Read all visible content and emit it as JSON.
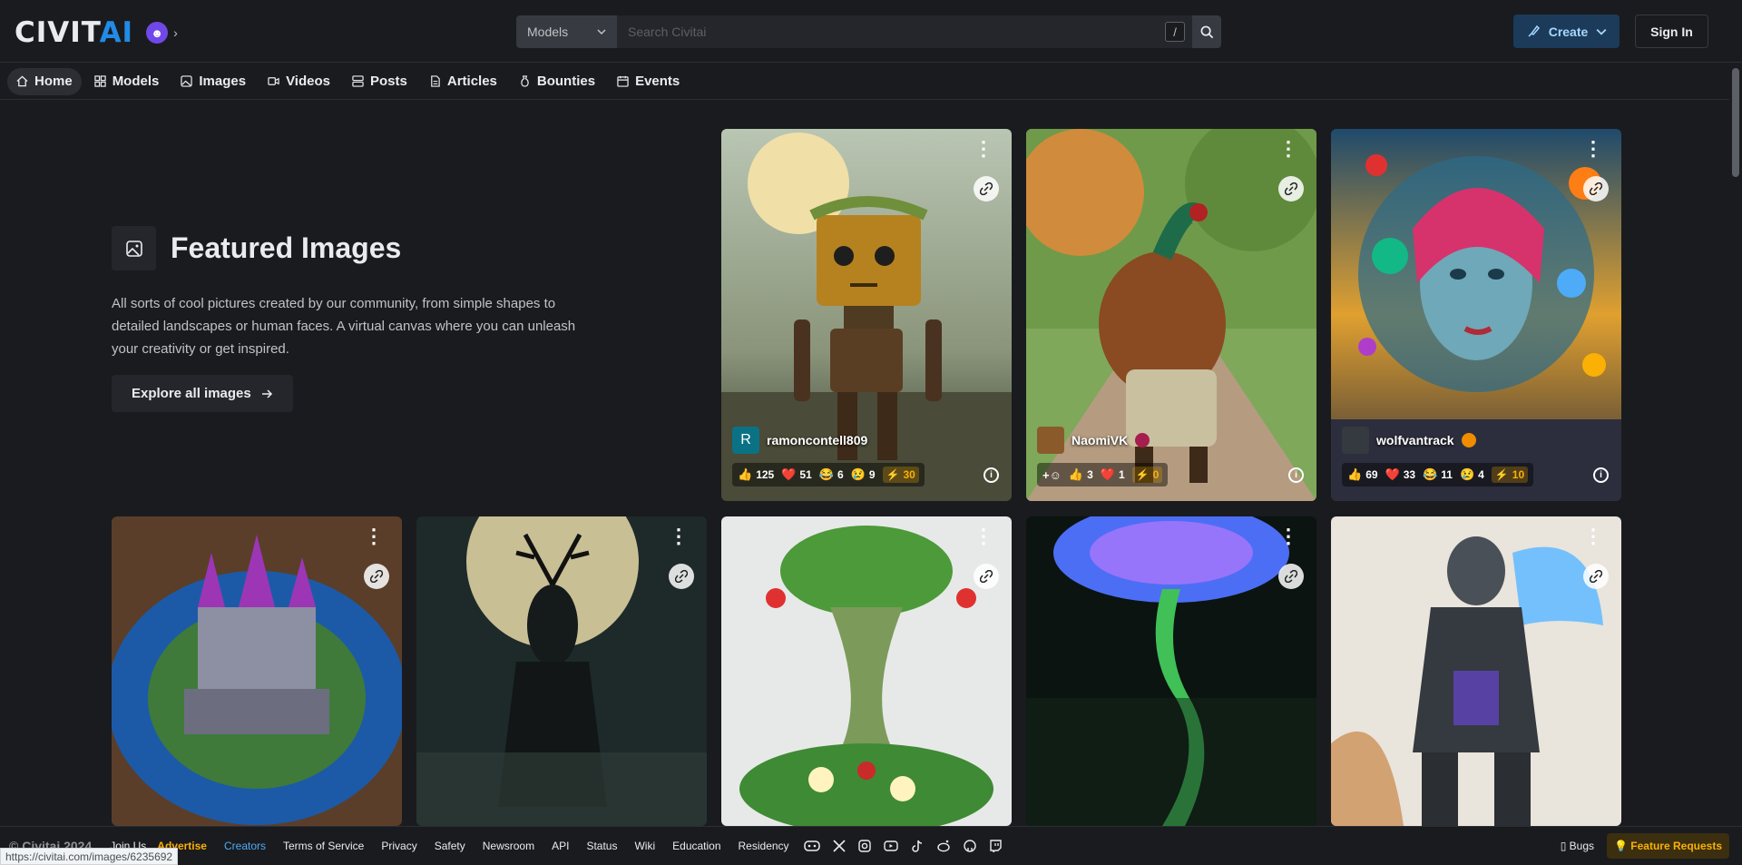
{
  "header": {
    "logo_text_left": "CIVIT",
    "logo_text_right": "AI",
    "search_type": "Models",
    "search_placeholder": "Search Civitai",
    "search_shortcut": "/",
    "create_label": "Create",
    "signin_label": "Sign In"
  },
  "nav": {
    "items": [
      {
        "label": "Home",
        "icon": "home-icon",
        "active": true
      },
      {
        "label": "Models",
        "icon": "grid-icon"
      },
      {
        "label": "Images",
        "icon": "image-icon"
      },
      {
        "label": "Videos",
        "icon": "video-icon"
      },
      {
        "label": "Posts",
        "icon": "list-icon"
      },
      {
        "label": "Articles",
        "icon": "file-icon"
      },
      {
        "label": "Bounties",
        "icon": "moneybag-icon"
      },
      {
        "label": "Events",
        "icon": "calendar-icon"
      }
    ]
  },
  "featured": {
    "title": "Featured Images",
    "description": "All sorts of cool pictures created by our community, from simple shapes to detailed landscapes or human faces. A virtual canvas where you can unleash your creativity or get inspired.",
    "explore_label": "Explore all images"
  },
  "cards": [
    {
      "user": "ramoncontell809",
      "avatar_letter": "R",
      "avatar_color": "#0b7285",
      "like": "125",
      "heart": "51",
      "laugh": "6",
      "cry": "9",
      "buzz": "30"
    },
    {
      "user": "NaomiVK",
      "avatar_letter": "",
      "avatar_color": "#8b5a2b",
      "like": "3",
      "heart": "1",
      "buzz": "0",
      "has_add": true
    },
    {
      "user": "wolfvantrack",
      "avatar_letter": "",
      "avatar_color": "#343a40",
      "like": "69",
      "heart": "33",
      "laugh": "11",
      "cry": "4",
      "buzz": "10"
    }
  ],
  "footer": {
    "copyright": "© Civitai 2024",
    "join": "Join Us",
    "links": [
      "Advertise",
      "Creators",
      "Terms of Service",
      "Privacy",
      "Safety",
      "Newsroom",
      "API",
      "Status",
      "Wiki",
      "Education",
      "Residency"
    ],
    "bugs": "Bugs",
    "feature_requests": "Feature Requests",
    "social_icons": [
      "discord-icon",
      "x-icon",
      "instagram-icon",
      "youtube-icon",
      "tiktok-icon",
      "reddit-icon",
      "github-icon",
      "twitch-icon"
    ]
  },
  "status_url": "https://civitai.com/images/6235692",
  "colors": {
    "background": "#1a1b1e",
    "accent": "#228be6",
    "buzz": "#fab005"
  }
}
